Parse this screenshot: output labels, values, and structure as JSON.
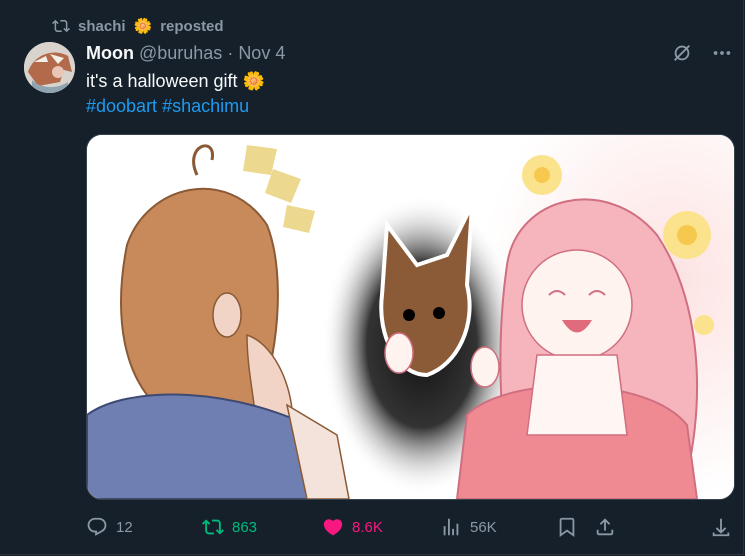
{
  "repost": {
    "user": "shachi",
    "emoji": "🌼",
    "label": "reposted"
  },
  "post": {
    "name": "Moon",
    "handle": "@buruhas",
    "dot": "·",
    "time": "Nov 4",
    "text": "it's a halloween gift",
    "text_emoji": "🌼",
    "hashtags": [
      "#doobart",
      "#shachimu"
    ]
  },
  "stats": {
    "replies": "12",
    "reposts": "863",
    "likes": "8.6K",
    "views": "56K"
  },
  "colors": {
    "background": "#15202b",
    "muted": "#8b98a5",
    "link": "#1d9bf0",
    "repost_green": "#00ba7c",
    "like_pink": "#f91880"
  }
}
